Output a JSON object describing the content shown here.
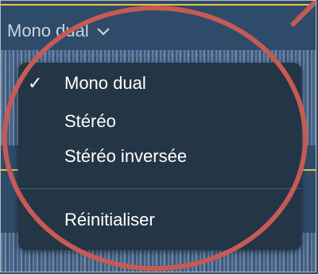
{
  "trigger": {
    "label": "Mono dual",
    "icon": "chevron-down-icon"
  },
  "menu": {
    "items": [
      {
        "label": "Mono dual",
        "checked": true,
        "check_glyph": "✓"
      },
      {
        "label": "Stéréo",
        "checked": false
      },
      {
        "label": "Stéréo inversée",
        "checked": false
      }
    ],
    "reset": {
      "label": "Réinitialiser"
    }
  },
  "colors": {
    "menu_background": "#243545",
    "highlight_circle": "#c75a54",
    "track_line": "#e0c341"
  }
}
